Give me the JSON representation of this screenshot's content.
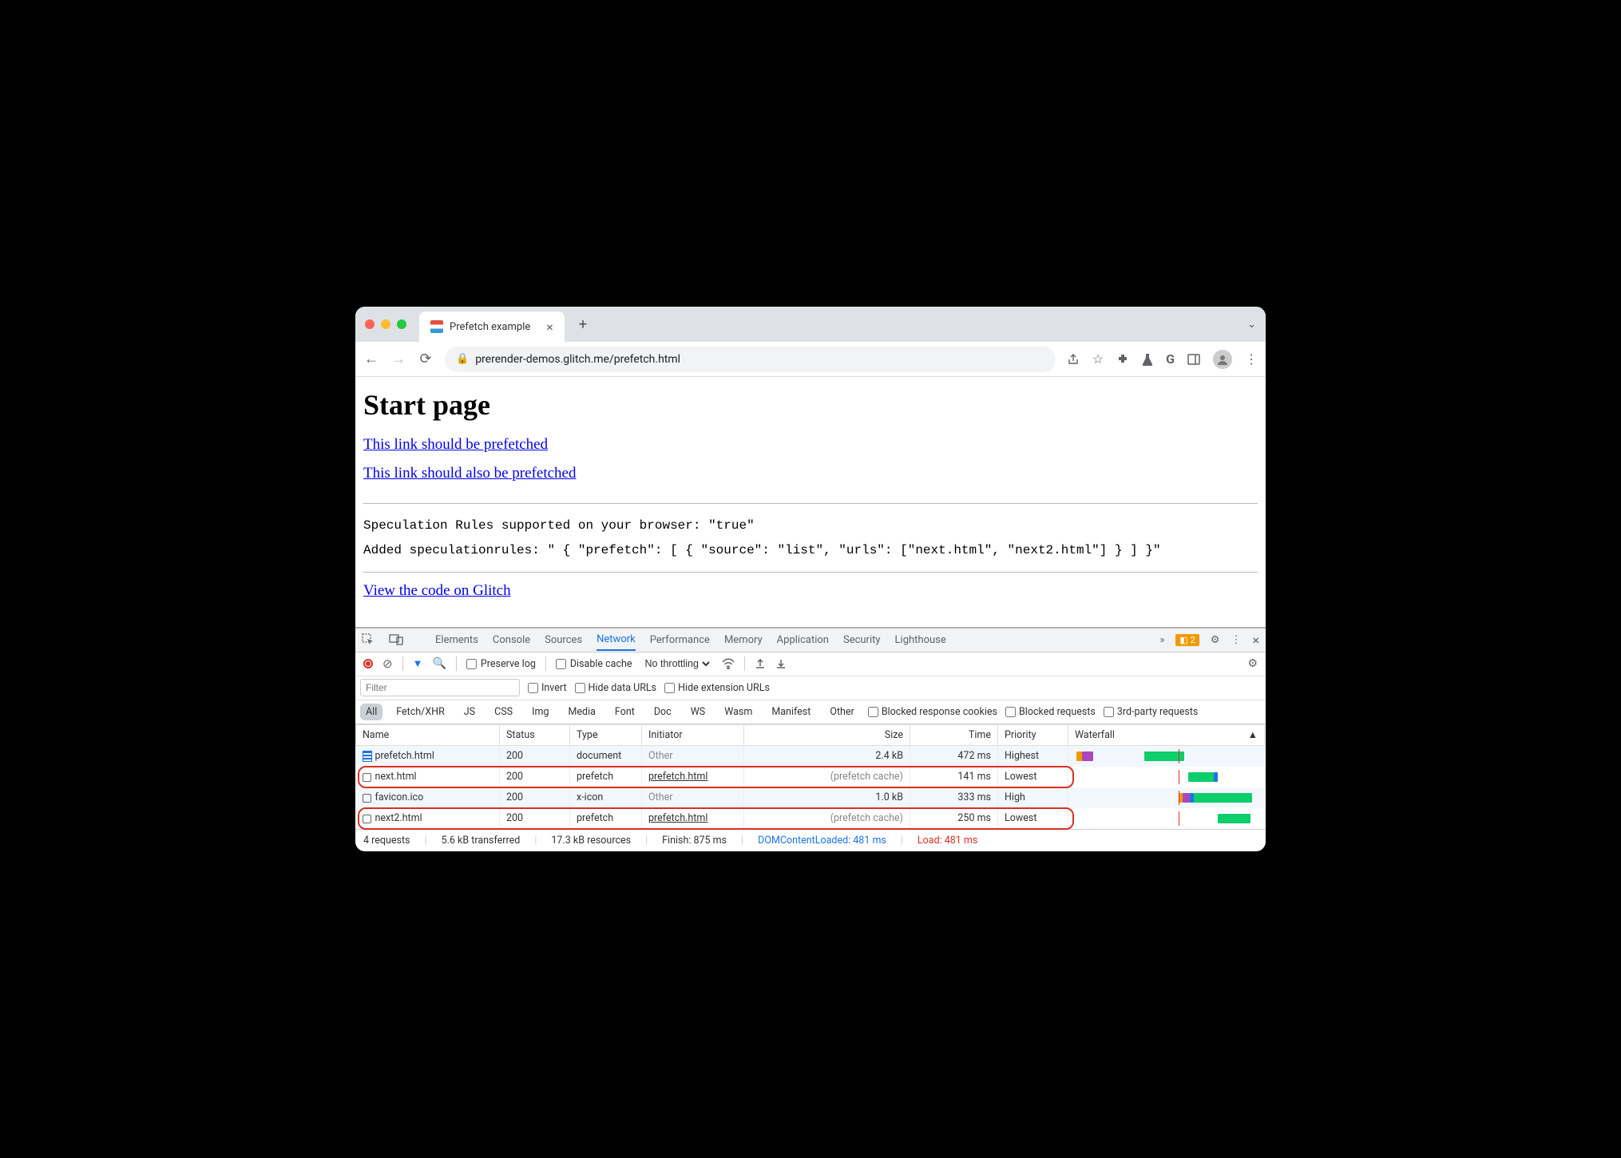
{
  "titlebar": {
    "tab_title": "Prefetch example",
    "chevron": "⌄"
  },
  "toolbar": {
    "url": "prerender-demos.glitch.me/prefetch.html"
  },
  "page": {
    "heading": "Start page",
    "link1": "This link should be prefetched",
    "link2": "This link should also be prefetched",
    "line1": "Speculation Rules supported on your browser: \"true\"",
    "line2": "Added speculationrules: \" { \"prefetch\": [ { \"source\": \"list\", \"urls\": [\"next.html\", \"next2.html\"] } ] }\"",
    "link3": "View the code on Glitch"
  },
  "devtools": {
    "tabs": {
      "elements": "Elements",
      "console": "Console",
      "sources": "Sources",
      "network": "Network",
      "performance": "Performance",
      "memory": "Memory",
      "application": "Application",
      "security": "Security",
      "lighthouse": "Lighthouse"
    },
    "warning_count": "2",
    "bar": {
      "preserve": "Preserve log",
      "disable_cache": "Disable cache",
      "throttling": "No throttling"
    },
    "filter": {
      "placeholder": "Filter",
      "invert": "Invert",
      "hide_data": "Hide data URLs",
      "hide_ext": "Hide extension URLs"
    },
    "types": {
      "all": "All",
      "fetchxhr": "Fetch/XHR",
      "js": "JS",
      "css": "CSS",
      "img": "Img",
      "media": "Media",
      "font": "Font",
      "doc": "Doc",
      "ws": "WS",
      "wasm": "Wasm",
      "manifest": "Manifest",
      "other": "Other",
      "blocked_cookies": "Blocked response cookies",
      "blocked_req": "Blocked requests",
      "third_party": "3rd-party requests"
    },
    "columns": {
      "name": "Name",
      "status": "Status",
      "type": "Type",
      "initiator": "Initiator",
      "size": "Size",
      "time": "Time",
      "priority": "Priority",
      "waterfall": "Waterfall"
    },
    "rows": [
      {
        "name": "prefetch.html",
        "status": "200",
        "type": "document",
        "initiator": "Other",
        "initiator_muted": true,
        "size": "2.4 kB",
        "time": "472 ms",
        "priority": "Highest",
        "docicon": true,
        "highlight": false,
        "wf": [
          {
            "l": 1,
            "w": 3,
            "c": "#f29900"
          },
          {
            "l": 4,
            "w": 6,
            "c": "#ab47bc"
          },
          {
            "l": 38,
            "w": 22,
            "c": "#0cce6b"
          }
        ]
      },
      {
        "name": "next.html",
        "status": "200",
        "type": "prefetch",
        "initiator": "prefetch.html",
        "initiator_muted": false,
        "size": "(prefetch cache)",
        "size_muted": true,
        "time": "141 ms",
        "priority": "Lowest",
        "highlight": true,
        "wf": [
          {
            "l": 62,
            "w": 14,
            "c": "#0cce6b"
          },
          {
            "l": 76,
            "w": 2,
            "c": "#1a73e8"
          }
        ]
      },
      {
        "name": "favicon.ico",
        "status": "200",
        "type": "x-icon",
        "initiator": "Other",
        "initiator_muted": true,
        "size": "1.0 kB",
        "time": "333 ms",
        "priority": "High",
        "highlight": false,
        "wf": [
          {
            "l": 57,
            "w": 2,
            "c": "#f29900"
          },
          {
            "l": 59,
            "w": 4,
            "c": "#ab47bc"
          },
          {
            "l": 63,
            "w": 2,
            "c": "#1a73e8"
          },
          {
            "l": 65,
            "w": 32,
            "c": "#0cce6b"
          }
        ]
      },
      {
        "name": "next2.html",
        "status": "200",
        "type": "prefetch",
        "initiator": "prefetch.html",
        "initiator_muted": false,
        "size": "(prefetch cache)",
        "size_muted": true,
        "time": "250 ms",
        "priority": "Lowest",
        "highlight": true,
        "wf": [
          {
            "l": 78,
            "w": 18,
            "c": "#0cce6b"
          }
        ]
      }
    ],
    "status": {
      "requests": "4 requests",
      "transferred": "5.6 kB transferred",
      "resources": "17.3 kB resources",
      "finish": "Finish: 875 ms",
      "dcl": "DOMContentLoaded: 481 ms",
      "load": "Load: 481 ms"
    }
  }
}
